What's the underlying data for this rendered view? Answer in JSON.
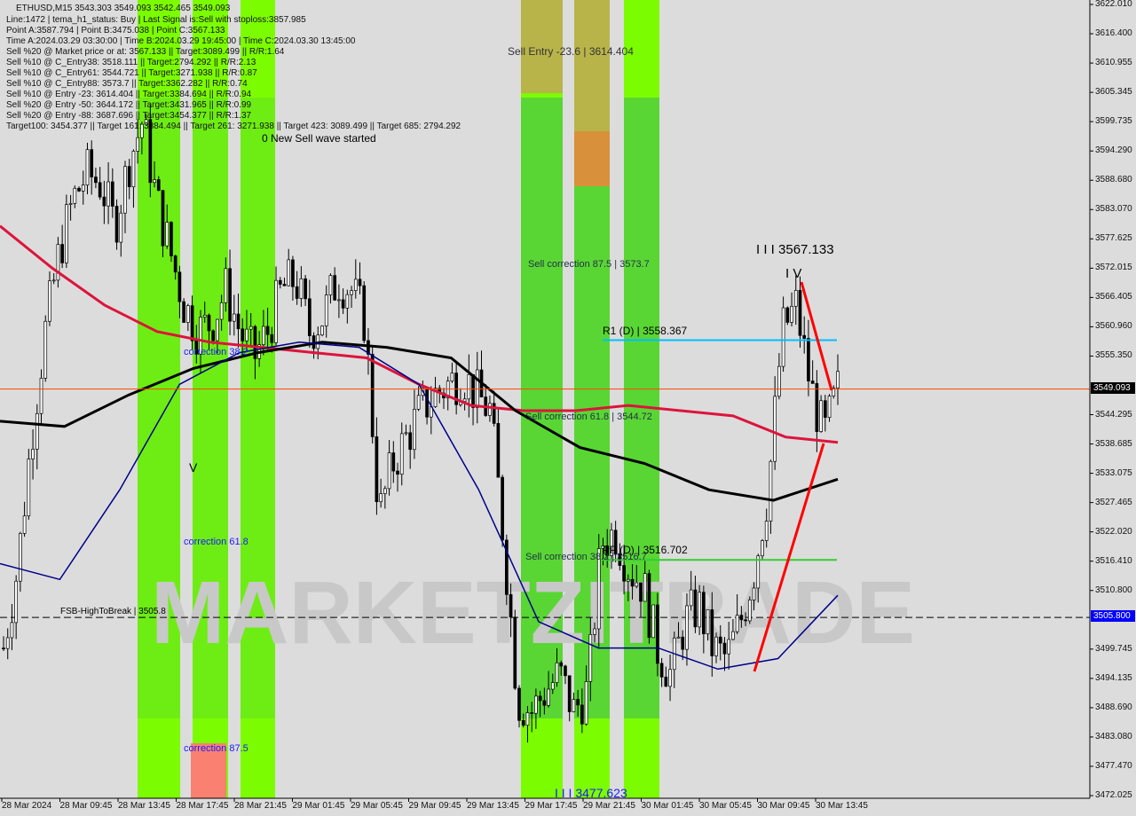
{
  "header": {
    "title": "ETHUSD,M15  3543.303 3549.093 3542.465 3549.093"
  },
  "info_lines": [
    "Line:1472 | tema_h1_status: Buy | Last Signal is:Sell with stoploss:3857.985",
    "Point A:3587.794 | Point B:3475.038 | Point C:3567.133",
    "Time A:2024.03.29 03:30:00 | Time B:2024.03.29 19:45:00 | Time C:2024.03.30 13:45:00",
    "Sell %20 @ Market price or at: 3567.133 || Target:3089.499 || R/R:1.64",
    "Sell %10 @ C_Entry38: 3518.111 || Target:2794.292 || R/R:2.13",
    "Sell %10 @ C_Entry61: 3544.721 || Target:3271.938 || R/R:0.87",
    "Sell %10 @ C_Entry88: 3573.7 || Target:3362.282 || R/R:0.74",
    "Sell %10 @ Entry -23: 3614.404 || Target:3384.694 || R/R:0.94",
    "Sell %20 @ Entry -50: 3644.172 || Target:3431.965 || R/R:0.99",
    "Sell %20 @ Entry -88: 3687.696 || Target:3454.377 || R/R:1.37",
    "Target100: 3454.377 || Target 161: 3384.494 || Target 261: 3271.938 || Target 423: 3089.499 || Target 685: 2794.292"
  ],
  "labels": {
    "wave": "0 New Sell wave started",
    "sell_entry": "Sell Entry -23.6 | 3614.404",
    "sc875": "Sell correction 87.5 | 3573.7",
    "sc618": "Sell correction 61.8 | 3544.72",
    "sc382": "Sell correction 38.2 | 3516.7",
    "r1": "R1 (D) | 3558.367",
    "pp": "PP (D) | 3516.702",
    "w3": "I I I 3567.133",
    "w4": "I V",
    "w3b": "I I I 3477.623",
    "c382": "correction 38.2",
    "c618": "correction 61.8",
    "c875": "correction 87.5",
    "v": "V",
    "fsb": "FSB-HighToBreak | 3505.8",
    "watermark": "MARKETZITRADE"
  },
  "chart_data": {
    "type": "candlestick",
    "symbol": "ETHUSD",
    "timeframe": "M15",
    "ylim": [
      3472.025,
      3622.01
    ],
    "y_ticks": [
      "3622.010",
      "3616.400",
      "3610.955",
      "3605.345",
      "3599.735",
      "3594.290",
      "3588.680",
      "3583.070",
      "3577.625",
      "3572.015",
      "3566.405",
      "3560.960",
      "3555.350",
      "3549.093",
      "3544.295",
      "3538.685",
      "3533.075",
      "3527.465",
      "3522.020",
      "3516.410",
      "3510.800",
      "3505.800",
      "3499.745",
      "3494.135",
      "3488.690",
      "3483.080",
      "3477.470",
      "3472.025"
    ],
    "x_ticks": [
      "28 Mar 2024",
      "28 Mar 09:45",
      "28 Mar 13:45",
      "28 Mar 17:45",
      "28 Mar 21:45",
      "29 Mar 01:45",
      "29 Mar 05:45",
      "29 Mar 09:45",
      "29 Mar 13:45",
      "29 Mar 17:45",
      "29 Mar 21:45",
      "30 Mar 01:45",
      "30 Mar 05:45",
      "30 Mar 09:45",
      "30 Mar 13:45"
    ],
    "current_price": 3549.093,
    "fsb_level": 3505.8,
    "r1": 3558.367,
    "pp": 3516.702,
    "price_path": [
      3500,
      3515,
      3540,
      3560,
      3575,
      3585,
      3590,
      3588,
      3580,
      3592,
      3600,
      3585,
      3575,
      3565,
      3560,
      3562,
      3568,
      3560,
      3555,
      3560,
      3568,
      3570,
      3560,
      3563,
      3570,
      3568,
      3562,
      3525,
      3535,
      3540,
      3545,
      3548,
      3550,
      3552,
      3548,
      3545,
      3520,
      3490,
      3488,
      3492,
      3495,
      3488,
      3492,
      3520,
      3522,
      3515,
      3512,
      3500,
      3495,
      3505,
      3508,
      3500,
      3498,
      3505,
      3515,
      3530,
      3560,
      3565,
      3550,
      3540,
      3549
    ],
    "ma_red": [
      3580,
      3572,
      3565,
      3560,
      3558,
      3557,
      3556,
      3555,
      3550,
      3546,
      3545,
      3545,
      3546,
      3545,
      3544,
      3540,
      3539
    ],
    "ma_black": [
      3543,
      3542,
      3548,
      3553,
      3556,
      3558,
      3557,
      3555,
      3545,
      3538,
      3535,
      3530,
      3528,
      3532
    ],
    "ma_blue": [
      3516,
      3513,
      3530,
      3550,
      3556,
      3558,
      3557,
      3550,
      3530,
      3505,
      3500,
      3500,
      3496,
      3498,
      3510
    ],
    "colors": {
      "zone_green": "#55d13a",
      "zone_lime": "#7cfc00",
      "ma_red": "#dc143c",
      "ma_black": "#000000",
      "ma_blue": "#00008b",
      "r1": "#00bfff",
      "pp": "#32cd32",
      "current": "#ff4500",
      "fsb_badge": "#0000ff"
    }
  }
}
